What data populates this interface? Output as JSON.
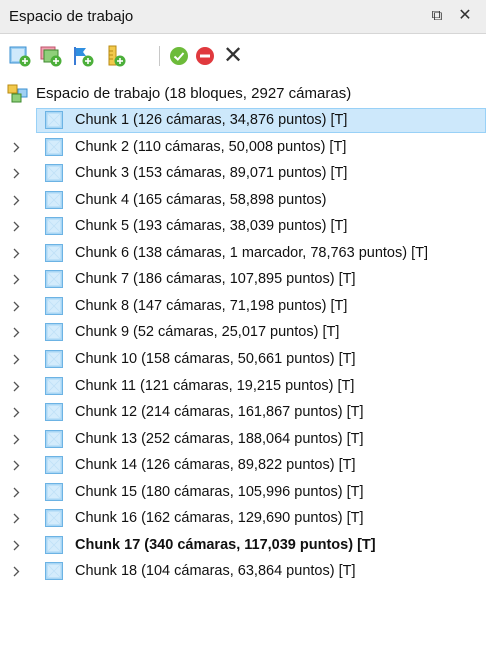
{
  "panel": {
    "title": "Espacio de trabajo",
    "float_glyph": "⧉",
    "close_glyph": "✕"
  },
  "toolbar": {
    "buttons": [
      {
        "name": "add-chunk-icon"
      },
      {
        "name": "add-photos-icon"
      },
      {
        "name": "add-marker-icon"
      },
      {
        "name": "add-scalebar-icon"
      },
      {
        "name": "enable-icon",
        "color": "#6dbb3a"
      },
      {
        "name": "disable-icon",
        "color": "#e0393e"
      },
      {
        "name": "remove-icon"
      }
    ],
    "remove_glyph": "✕"
  },
  "tree": {
    "root_label": "Espacio de trabajo (18 bloques, 2927 cámaras)",
    "chunks": [
      {
        "label": "Chunk 1 (126 cámaras, 34,876 puntos) [T]",
        "selected": true,
        "bold": false
      },
      {
        "label": "Chunk 2 (110 cámaras, 50,008 puntos) [T]",
        "selected": false,
        "bold": false
      },
      {
        "label": "Chunk 3 (153 cámaras, 89,071 puntos) [T]",
        "selected": false,
        "bold": false
      },
      {
        "label": "Chunk 4 (165 cámaras, 58,898 puntos)",
        "selected": false,
        "bold": false
      },
      {
        "label": "Chunk 5 (193 cámaras, 38,039 puntos) [T]",
        "selected": false,
        "bold": false
      },
      {
        "label": "Chunk 6 (138 cámaras, 1 marcador, 78,763 puntos) [T]",
        "selected": false,
        "bold": false
      },
      {
        "label": "Chunk 7 (186 cámaras, 107,895 puntos) [T]",
        "selected": false,
        "bold": false
      },
      {
        "label": "Chunk 8 (147 cámaras, 71,198 puntos) [T]",
        "selected": false,
        "bold": false
      },
      {
        "label": "Chunk 9 (52 cámaras, 25,017 puntos) [T]",
        "selected": false,
        "bold": false
      },
      {
        "label": "Chunk 10 (158 cámaras, 50,661 puntos) [T]",
        "selected": false,
        "bold": false
      },
      {
        "label": "Chunk 11 (121 cámaras, 19,215 puntos) [T]",
        "selected": false,
        "bold": false
      },
      {
        "label": "Chunk 12 (214 cámaras, 161,867 puntos) [T]",
        "selected": false,
        "bold": false
      },
      {
        "label": "Chunk 13 (252 cámaras, 188,064 puntos) [T]",
        "selected": false,
        "bold": false
      },
      {
        "label": "Chunk 14 (126 cámaras, 89,822 puntos) [T]",
        "selected": false,
        "bold": false
      },
      {
        "label": "Chunk 15 (180 cámaras, 105,996 puntos) [T]",
        "selected": false,
        "bold": false
      },
      {
        "label": "Chunk 16 (162 cámaras, 129,690 puntos) [T]",
        "selected": false,
        "bold": false
      },
      {
        "label": "Chunk 17 (340 cámaras, 117,039 puntos) [T]",
        "selected": false,
        "bold": true
      },
      {
        "label": "Chunk 18 (104 cámaras, 63,864 puntos) [T]",
        "selected": false,
        "bold": false
      }
    ]
  },
  "colors": {
    "selection_bg": "#cde8fb",
    "selection_border": "#99d1f7",
    "titlebar_bg": "#eeeeee"
  }
}
